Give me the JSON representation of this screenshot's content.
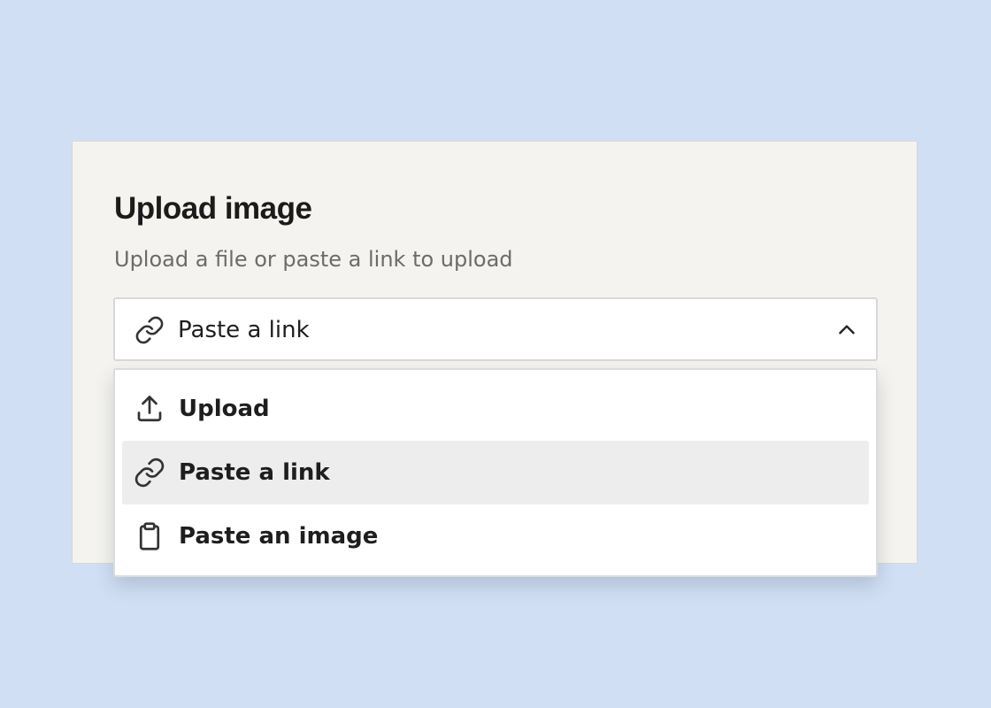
{
  "dialog": {
    "title": "Upload image",
    "subtitle": "Upload a file or paste a link to upload"
  },
  "select": {
    "value": "Paste a link",
    "icon": "link-icon",
    "expanded": true,
    "chevron_icon": "chevron-up-icon"
  },
  "menu": {
    "items": [
      {
        "label": "Upload",
        "icon": "upload-icon",
        "selected": false
      },
      {
        "label": "Paste a link",
        "icon": "link-icon",
        "selected": true
      },
      {
        "label": "Paste an image",
        "icon": "clipboard-icon",
        "selected": false
      }
    ]
  },
  "colors": {
    "background": "#d1dff5",
    "card": "#f4f3ef",
    "text": "#1e1e1e",
    "muted_text": "#6b6b6b",
    "selected_item": "#ededed",
    "icon_stroke": "#333333"
  }
}
